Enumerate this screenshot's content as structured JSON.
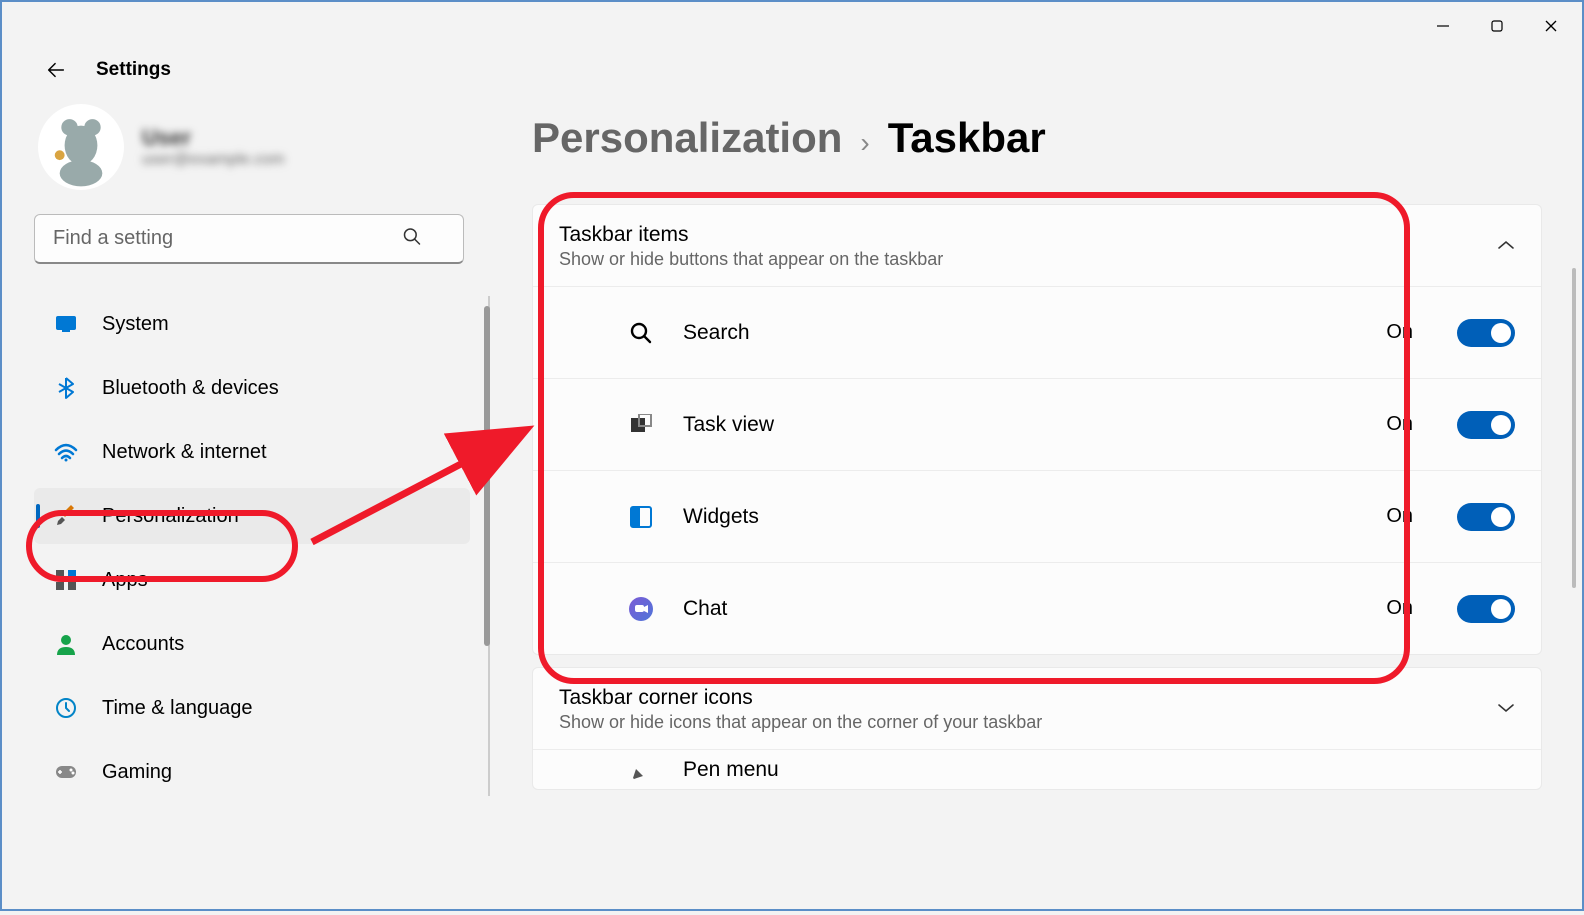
{
  "app_title": "Settings",
  "user": {
    "name": "User",
    "email": "user@example.com"
  },
  "search": {
    "placeholder": "Find a setting"
  },
  "sidebar": {
    "items": [
      {
        "label": "System",
        "selected": false
      },
      {
        "label": "Bluetooth & devices",
        "selected": false
      },
      {
        "label": "Network & internet",
        "selected": false
      },
      {
        "label": "Personalization",
        "selected": true
      },
      {
        "label": "Apps",
        "selected": false
      },
      {
        "label": "Accounts",
        "selected": false
      },
      {
        "label": "Time & language",
        "selected": false
      },
      {
        "label": "Gaming",
        "selected": false
      }
    ]
  },
  "breadcrumb": {
    "parent": "Personalization",
    "current": "Taskbar"
  },
  "panel1": {
    "title": "Taskbar items",
    "subtitle": "Show or hide buttons that appear on the taskbar",
    "rows": [
      {
        "label": "Search",
        "state": "On"
      },
      {
        "label": "Task view",
        "state": "On"
      },
      {
        "label": "Widgets",
        "state": "On"
      },
      {
        "label": "Chat",
        "state": "On"
      }
    ]
  },
  "panel2": {
    "title": "Taskbar corner icons",
    "subtitle": "Show or hide icons that appear on the corner of your taskbar",
    "row_preview": "Pen menu"
  }
}
